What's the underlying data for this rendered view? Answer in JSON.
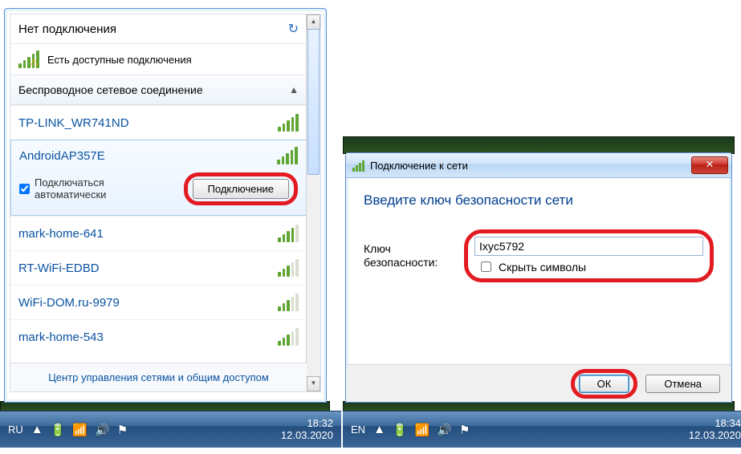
{
  "wifi_popup": {
    "no_connection": "Нет подключения",
    "available": "Есть доступные подключения",
    "wireless_header": "Беспроводное сетевое соединение",
    "auto_connect": "Подключаться автоматически",
    "connect_btn": "Подключение",
    "footer_link": "Центр управления сетями и общим доступом",
    "networks": [
      {
        "name": "TP-LINK_WR741ND",
        "strength": 5
      },
      {
        "name": "AndroidAP357E",
        "strength": 5,
        "selected": true
      },
      {
        "name": "mark-home-641",
        "strength": 4
      },
      {
        "name": "RT-WiFi-EDBD",
        "strength": 3
      },
      {
        "name": "WiFi-DOM.ru-9979",
        "strength": 3
      },
      {
        "name": "mark-home-543",
        "strength": 3
      }
    ]
  },
  "dialog": {
    "title": "Подключение к сети",
    "heading": "Введите ключ безопасности сети",
    "key_label": "Ключ безопасности:",
    "key_value": "Ixyc5792",
    "hide_chars": "Скрыть символы",
    "ok": "ОК",
    "cancel": "Отмена"
  },
  "taskbar1": {
    "lang": "RU",
    "time": "18:32",
    "date": "12.03.2020"
  },
  "taskbar2": {
    "lang": "EN",
    "time": "18:34",
    "date": "12.03.2020"
  }
}
